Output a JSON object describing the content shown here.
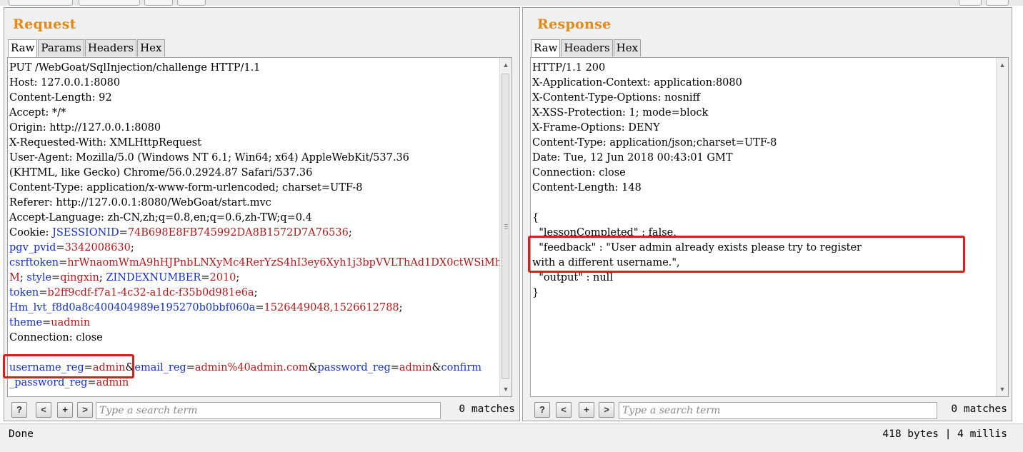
{
  "request": {
    "title": "Request",
    "tabs": [
      "Raw",
      "Params",
      "Headers",
      "Hex"
    ],
    "lines": [
      [
        {
          "t": "PUT /WebGoat/SqlInjection/challenge HTTP/1.1"
        }
      ],
      [
        {
          "t": "Host: 127.0.0.1:8080"
        }
      ],
      [
        {
          "t": "Content-Length: 92"
        }
      ],
      [
        {
          "t": "Accept: */*"
        }
      ],
      [
        {
          "t": "Origin: http://127.0.0.1:8080"
        }
      ],
      [
        {
          "t": "X-Requested-With: XMLHttpRequest"
        }
      ],
      [
        {
          "t": "User-Agent: Mozilla/5.0 (Windows NT 6.1; Win64; x64) AppleWebKit/537.36"
        }
      ],
      [
        {
          "t": "(KHTML, like Gecko) Chrome/56.0.2924.87 Safari/537.36"
        }
      ],
      [
        {
          "t": "Content-Type: application/x-www-form-urlencoded; charset=UTF-8"
        }
      ],
      [
        {
          "t": "Referer: http://127.0.0.1:8080/WebGoat/start.mvc"
        }
      ],
      [
        {
          "t": "Accept-Language: zh-CN,zh;q=0.8,en;q=0.6,zh-TW;q=0.4"
        }
      ],
      [
        {
          "t": "Cookie: "
        },
        {
          "t": "JSESSIONID",
          "c": "k"
        },
        {
          "t": "="
        },
        {
          "t": "74B698E8FB745992DA8B1572D7A76536",
          "c": "v"
        },
        {
          "t": ";"
        }
      ],
      [
        {
          "t": "pgv_pvid",
          "c": "k"
        },
        {
          "t": "="
        },
        {
          "t": "3342008630",
          "c": "v"
        },
        {
          "t": ";"
        }
      ],
      [
        {
          "t": "csrftoken",
          "c": "k"
        },
        {
          "t": "="
        },
        {
          "t": "hrWnaomWmA9hHJPnbLNXyMc4RerYzS4hI3ey6Xyh1j3bpVVLThAd1DX0ctWSiMh",
          "c": "v"
        }
      ],
      [
        {
          "t": "M",
          "c": "v"
        },
        {
          "t": "; "
        },
        {
          "t": "style",
          "c": "k"
        },
        {
          "t": "="
        },
        {
          "t": "qingxin",
          "c": "v"
        },
        {
          "t": "; "
        },
        {
          "t": "ZINDEXNUMBER",
          "c": "k"
        },
        {
          "t": "="
        },
        {
          "t": "2010",
          "c": "v"
        },
        {
          "t": ";"
        }
      ],
      [
        {
          "t": "token",
          "c": "k"
        },
        {
          "t": "="
        },
        {
          "t": "b2ff9cdf-f7a1-4c32-a1dc-f35b0d981e6a",
          "c": "v"
        },
        {
          "t": ";"
        }
      ],
      [
        {
          "t": "Hm_lvt_f8d0a8c400404989e195270b0bbf060a",
          "c": "k"
        },
        {
          "t": "="
        },
        {
          "t": "1526449048,1526612788",
          "c": "v"
        },
        {
          "t": ";"
        }
      ],
      [
        {
          "t": "theme",
          "c": "k"
        },
        {
          "t": "="
        },
        {
          "t": "uadmin",
          "c": "v"
        }
      ],
      [
        {
          "t": "Connection: close"
        }
      ],
      [
        {
          "t": ""
        }
      ],
      [
        {
          "t": "username_reg",
          "c": "k"
        },
        {
          "t": "="
        },
        {
          "t": "admin",
          "c": "v"
        },
        {
          "t": "&"
        },
        {
          "t": "email_reg",
          "c": "k"
        },
        {
          "t": "="
        },
        {
          "t": "admin%40admin.com",
          "c": "v"
        },
        {
          "t": "&"
        },
        {
          "t": "password_reg",
          "c": "k"
        },
        {
          "t": "="
        },
        {
          "t": "admin",
          "c": "v"
        },
        {
          "t": "&"
        },
        {
          "t": "confirm",
          "c": "k"
        }
      ],
      [
        {
          "t": "_password_reg",
          "c": "k"
        },
        {
          "t": "="
        },
        {
          "t": "admin",
          "c": "v"
        }
      ]
    ],
    "search_placeholder": "Type a search term",
    "matches": "0 matches"
  },
  "response": {
    "title": "Response",
    "tabs": [
      "Raw",
      "Headers",
      "Hex"
    ],
    "lines": [
      [
        {
          "t": "HTTP/1.1 200"
        }
      ],
      [
        {
          "t": "X-Application-Context: application:8080"
        }
      ],
      [
        {
          "t": "X-Content-Type-Options: nosniff"
        }
      ],
      [
        {
          "t": "X-XSS-Protection: 1; mode=block"
        }
      ],
      [
        {
          "t": "X-Frame-Options: DENY"
        }
      ],
      [
        {
          "t": "Content-Type: application/json;charset=UTF-8"
        }
      ],
      [
        {
          "t": "Date: Tue, 12 Jun 2018 00:43:01 GMT"
        }
      ],
      [
        {
          "t": "Connection: close"
        }
      ],
      [
        {
          "t": "Content-Length: 148"
        }
      ],
      [
        {
          "t": ""
        }
      ],
      [
        {
          "t": "{"
        }
      ],
      [
        {
          "t": "  \"lessonCompleted\" : false,"
        }
      ],
      [
        {
          "t": "  \"feedback\" : \"User admin already exists please try to register"
        }
      ],
      [
        {
          "t": "with a different username.\","
        }
      ],
      [
        {
          "t": "  \"output\" : null"
        }
      ],
      [
        {
          "t": "}"
        }
      ]
    ],
    "search_placeholder": "Type a search term",
    "matches": "0 matches"
  },
  "search_buttons": {
    "help": "?",
    "prev": "<",
    "add": "+",
    "next": ">"
  },
  "status": {
    "text": "Done",
    "bytes": "418 bytes",
    "separator": "|",
    "time": "4 millis"
  },
  "colors": {
    "title": "#e58a10",
    "param_name": "#1430c8",
    "param_value": "#b01818",
    "highlight": "#e41b1b"
  }
}
